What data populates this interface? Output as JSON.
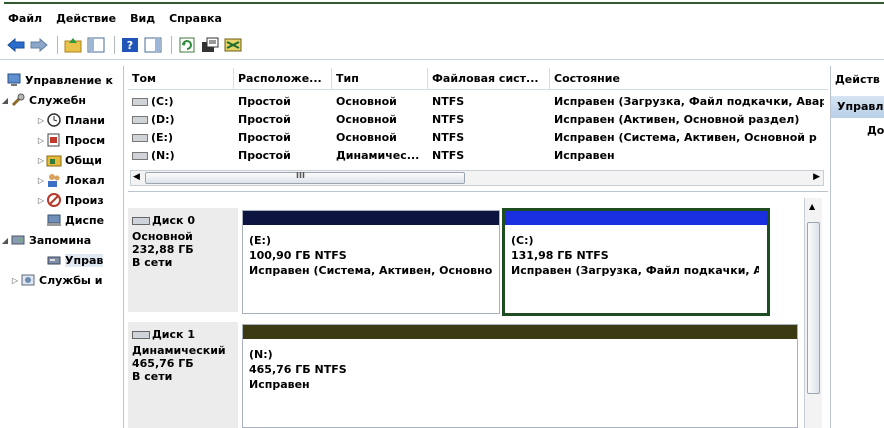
{
  "menu": {
    "file": "Файл",
    "action": "Действие",
    "view": "Вид",
    "help": "Справка"
  },
  "tree": {
    "items": [
      {
        "label": "Управление к",
        "icon": "computer-management-icon"
      },
      {
        "label": "Служебн",
        "icon": "tools-icon"
      },
      {
        "label": "Плани",
        "icon": "clock-icon"
      },
      {
        "label": "Просм",
        "icon": "event-viewer-icon"
      },
      {
        "label": "Общи",
        "icon": "shared-folders-icon"
      },
      {
        "label": "Локал",
        "icon": "users-icon"
      },
      {
        "label": "Произ",
        "icon": "performance-icon"
      },
      {
        "label": "Диспе",
        "icon": "device-manager-icon"
      },
      {
        "label": "Запомина",
        "icon": "storage-icon"
      },
      {
        "label": "Управ",
        "icon": "disk-management-icon"
      },
      {
        "label": "Службы и",
        "icon": "services-icon"
      }
    ]
  },
  "list": {
    "columns": [
      "Том",
      "Расположе...",
      "Тип",
      "Файловая сист...",
      "Состояние"
    ],
    "rows": [
      [
        "(C:)",
        "Простой",
        "Основной",
        "NTFS",
        "Исправен (Загрузка, Файл подкачки, Авар"
      ],
      [
        "(D:)",
        "Простой",
        "Основной",
        "NTFS",
        "Исправен (Активен, Основной раздел)"
      ],
      [
        "(E:)",
        "Простой",
        "Основной",
        "NTFS",
        "Исправен (Система, Активен, Основной р"
      ],
      [
        "(N:)",
        "Простой",
        "Динамичес...",
        "NTFS",
        "Исправен"
      ]
    ],
    "scroll_marker": "III"
  },
  "disks": [
    {
      "name": "Диск 0",
      "type": "Основной",
      "size": "232,88 ГБ",
      "status": "В сети",
      "volumes": [
        {
          "name": "(E:)",
          "size": "100,90 ГБ NTFS",
          "status": "Исправен (Система, Активен, Основно"
        },
        {
          "name": "(C:)",
          "size": "131,98 ГБ NTFS",
          "status": "Исправен (Загрузка, Файл подкачки, А"
        }
      ]
    },
    {
      "name": "Диск 1",
      "type": "Динамический",
      "size": "465,76 ГБ",
      "status": "В сети",
      "volumes": [
        {
          "name": "(N:)",
          "size": "465,76 ГБ NTFS",
          "status": "Исправен"
        }
      ]
    }
  ],
  "actions": {
    "header": "Действ",
    "selected": "Управл",
    "item": "До"
  },
  "colors": {
    "primary_bar": "#0c1440",
    "selected_bar": "#1a2fe0",
    "dynamic_bar": "#3c3a12",
    "selection_border": "#1e4d22"
  }
}
